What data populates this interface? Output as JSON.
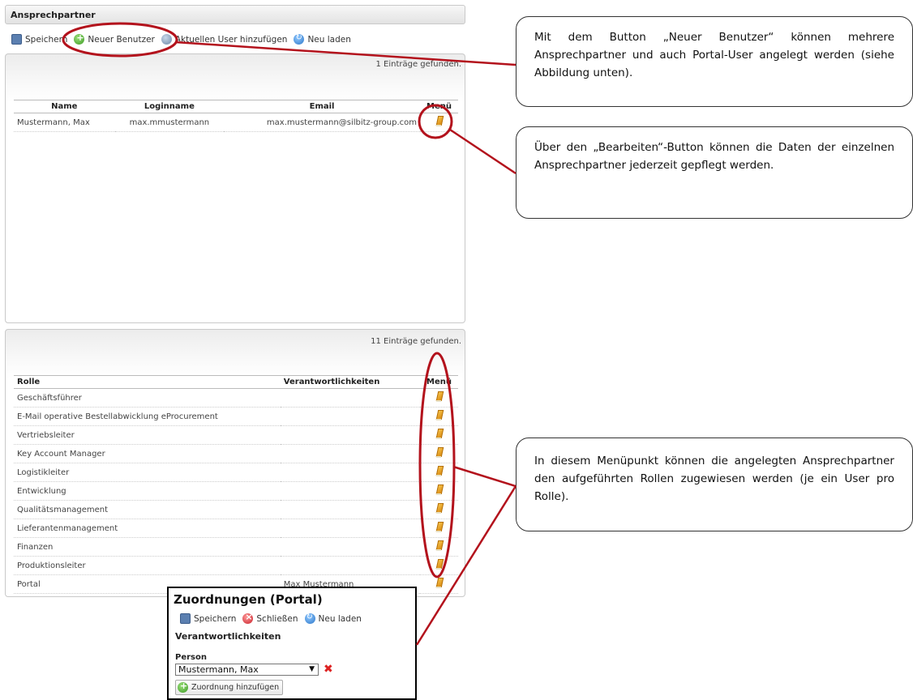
{
  "panel": {
    "title": "Ansprechpartner"
  },
  "toolbar": {
    "save": "Speichern",
    "new_user": "Neuer Benutzer",
    "add_current": "Aktuellen User hinzufügen",
    "reload": "Neu laden"
  },
  "users_grid": {
    "found": "1 Einträge gefunden.",
    "columns": [
      "Name",
      "Loginname",
      "Email",
      "Menü"
    ],
    "rows": [
      {
        "name": "Mustermann, Max",
        "login": "max.mmustermann",
        "email": "max.mustermann@silbitz-group.com"
      }
    ]
  },
  "roles_grid": {
    "found": "11 Einträge gefunden.",
    "columns": [
      "Rolle",
      "Verantwortlichkeiten",
      "Menü"
    ],
    "rows": [
      {
        "role": "Geschäftsführer",
        "resp": ""
      },
      {
        "role": "E-Mail operative Bestellabwicklung eProcurement",
        "resp": ""
      },
      {
        "role": "Vertriebsleiter",
        "resp": ""
      },
      {
        "role": "Key Account Manager",
        "resp": ""
      },
      {
        "role": "Logistikleiter",
        "resp": ""
      },
      {
        "role": "Entwicklung",
        "resp": ""
      },
      {
        "role": "Qualitätsmanagement",
        "resp": ""
      },
      {
        "role": "Lieferantenmanagement",
        "resp": ""
      },
      {
        "role": "Finanzen",
        "resp": ""
      },
      {
        "role": "Produktionsleiter",
        "resp": ""
      },
      {
        "role": "Portal",
        "resp": "Max Mustermann"
      }
    ]
  },
  "popup": {
    "title": "Zuordnungen (Portal)",
    "save": "Speichern",
    "close": "Schließen",
    "reload": "Neu laden",
    "section": "Verantwortlichkeiten",
    "person_label": "Person",
    "person_value": "Mustermann, Max",
    "add_assignment": "Zuordnung hinzufügen"
  },
  "callouts": {
    "new_user": "Mit dem Button „Neuer Benutzer“ können mehrere Ansprechpartner und auch Portal-User angelegt werden (siehe Abbildung unten).",
    "edit": "Über den „Bearbeiten“-Button können die Daten der einzelnen Ansprechpartner jederzeit gepflegt werden.",
    "roles": "In diesem Menüpunkt können die angelegten Ansprechpartner den aufgeführten Rollen zugewiesen werden (je ein User pro Rolle)."
  },
  "colors": {
    "annotation_red": "#b3121c"
  }
}
